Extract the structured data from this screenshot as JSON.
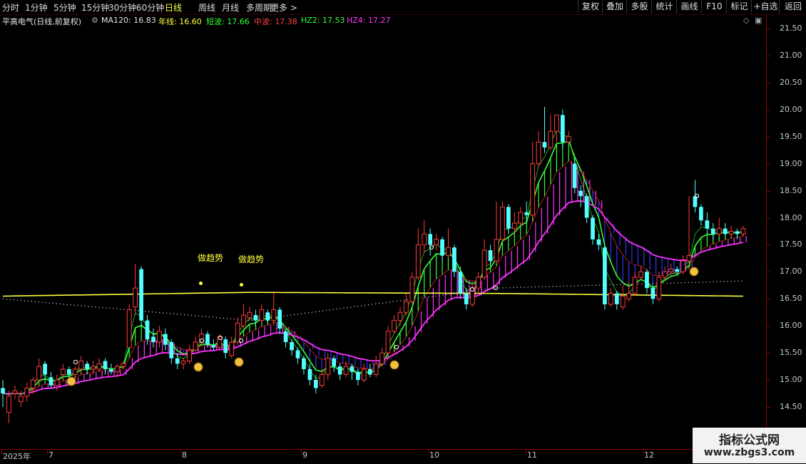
{
  "toolbar": {
    "periods": [
      {
        "label": "分时",
        "active": false
      },
      {
        "label": "1分钟",
        "active": false
      },
      {
        "label": "5分钟",
        "active": false
      },
      {
        "label": "15分钟",
        "active": false
      },
      {
        "label": "30分钟",
        "active": false
      },
      {
        "label": "60分钟",
        "active": false
      },
      {
        "label": "日线",
        "active": true
      },
      {
        "label": "周线",
        "active": false
      },
      {
        "label": "月线",
        "active": false
      },
      {
        "label": "多周期",
        "active": false
      },
      {
        "label": "更多 >",
        "active": false
      }
    ],
    "right_buttons": [
      "复权",
      "叠加",
      "多股",
      "统计",
      "画线",
      "F10",
      "标记",
      "+自选",
      "返回"
    ]
  },
  "info": {
    "stock_title": "平高电气(日线,前复权)",
    "ma_label": "MA120: 16.83",
    "nianxian": "年线: 16.60",
    "duanbo": "短波: 17.66",
    "zhongbo": "中波: 17.38",
    "hz2": "HZ2: 17.53",
    "hz4": "HZ4: 17.27"
  },
  "colors": {
    "up": "#ff3b3b",
    "down": "#54ffff",
    "yellow": "#ffff40",
    "green_band": "#33ff33",
    "magenta_band": "#ff33ff",
    "blue_band": "#3333ff",
    "white_dots": "#e0e0e0"
  },
  "y_axis": [
    "21.50",
    "21.00",
    "20.50",
    "20.00",
    "19.50",
    "19.00",
    "18.50",
    "18.00",
    "17.50",
    "17.00",
    "16.50",
    "16.00",
    "15.50",
    "15.00",
    "14.50"
  ],
  "x_axis": [
    "2025年",
    "7",
    "8",
    "9",
    "10",
    "11",
    "12"
  ],
  "annotations": [
    "做趋势",
    "做趋势"
  ],
  "watermark": {
    "line1": "指标公式网",
    "line2": "www.zbgs3.com"
  },
  "chart_data": {
    "type": "candlestick",
    "title": "平高电气(日线,前复权)",
    "ylim": [
      14.2,
      21.7
    ],
    "candles": [
      [
        14.85,
        14.75,
        15.0,
        14.5
      ],
      [
        14.4,
        14.7,
        14.8,
        14.2
      ],
      [
        14.75,
        14.8,
        14.9,
        14.65
      ],
      [
        14.6,
        14.7,
        14.8,
        14.5
      ],
      [
        14.7,
        14.85,
        14.95,
        14.6
      ],
      [
        14.85,
        15.0,
        15.05,
        14.75
      ],
      [
        15.0,
        15.25,
        15.4,
        14.95
      ],
      [
        15.3,
        15.1,
        15.35,
        15.0
      ],
      [
        15.05,
        14.9,
        15.15,
        14.85
      ],
      [
        14.9,
        15.0,
        15.1,
        14.8
      ],
      [
        15.1,
        15.2,
        15.3,
        15.0
      ],
      [
        15.2,
        15.1,
        15.25,
        15.05
      ],
      [
        15.1,
        15.2,
        15.25,
        15.0
      ],
      [
        15.2,
        15.35,
        15.45,
        15.1
      ],
      [
        15.3,
        15.2,
        15.35,
        15.1
      ],
      [
        15.2,
        15.25,
        15.35,
        15.1
      ],
      [
        15.2,
        15.3,
        15.4,
        15.15
      ],
      [
        15.35,
        15.2,
        15.4,
        15.1
      ],
      [
        15.2,
        15.15,
        15.3,
        15.1
      ],
      [
        15.15,
        15.25,
        15.3,
        15.05
      ],
      [
        15.25,
        15.3,
        15.35,
        15.2
      ],
      [
        15.6,
        16.3,
        16.4,
        15.6
      ],
      [
        16.35,
        16.7,
        17.15,
        16.2
      ],
      [
        17.05,
        16.1,
        17.1,
        16.0
      ],
      [
        16.1,
        15.75,
        16.2,
        15.65
      ],
      [
        15.8,
        15.7,
        15.95,
        15.6
      ],
      [
        15.7,
        15.9,
        16.0,
        15.6
      ],
      [
        15.85,
        15.65,
        15.95,
        15.55
      ],
      [
        15.7,
        15.4,
        15.75,
        15.3
      ],
      [
        15.4,
        15.3,
        15.5,
        15.2
      ],
      [
        15.3,
        15.35,
        15.4,
        15.2
      ],
      [
        15.35,
        15.55,
        15.65,
        15.3
      ],
      [
        15.55,
        15.7,
        15.8,
        15.5
      ],
      [
        15.7,
        15.85,
        15.95,
        15.65
      ],
      [
        15.85,
        15.65,
        15.9,
        15.6
      ],
      [
        15.65,
        15.6,
        15.75,
        15.55
      ],
      [
        15.6,
        15.8,
        15.85,
        15.55
      ],
      [
        15.75,
        15.5,
        15.8,
        15.4
      ],
      [
        15.45,
        15.7,
        15.8,
        15.4
      ],
      [
        15.7,
        16.05,
        16.15,
        15.65
      ],
      [
        16.0,
        16.2,
        16.4,
        15.95
      ],
      [
        16.15,
        16.25,
        16.35,
        16.1
      ],
      [
        16.2,
        16.1,
        16.3,
        16.0
      ],
      [
        16.1,
        16.3,
        16.4,
        16.05
      ],
      [
        16.25,
        16.1,
        16.3,
        16.05
      ],
      [
        16.1,
        16.3,
        16.6,
        16.0
      ],
      [
        16.3,
        15.95,
        16.35,
        15.85
      ],
      [
        15.9,
        15.7,
        15.95,
        15.6
      ],
      [
        15.7,
        15.55,
        15.75,
        15.45
      ],
      [
        15.55,
        15.4,
        15.6,
        15.3
      ],
      [
        15.4,
        15.2,
        15.45,
        15.1
      ],
      [
        15.2,
        15.0,
        15.3,
        14.9
      ],
      [
        15.0,
        14.85,
        15.1,
        14.75
      ],
      [
        14.9,
        15.1,
        15.2,
        14.85
      ],
      [
        15.1,
        15.4,
        15.5,
        15.0
      ],
      [
        15.4,
        15.25,
        15.45,
        15.15
      ],
      [
        15.25,
        15.1,
        15.3,
        15.0
      ],
      [
        15.1,
        15.25,
        15.35,
        15.05
      ],
      [
        15.25,
        15.15,
        15.3,
        15.0
      ],
      [
        15.15,
        15.0,
        15.2,
        14.9
      ],
      [
        15.0,
        15.2,
        15.3,
        14.95
      ],
      [
        15.2,
        15.1,
        15.3,
        15.05
      ],
      [
        15.1,
        15.3,
        15.45,
        15.05
      ],
      [
        15.3,
        15.5,
        15.6,
        15.25
      ],
      [
        15.5,
        15.9,
        16.0,
        15.45
      ],
      [
        15.9,
        16.1,
        16.2,
        15.85
      ],
      [
        16.1,
        16.25,
        16.35,
        16.0
      ],
      [
        16.25,
        16.45,
        16.6,
        16.2
      ],
      [
        16.45,
        16.9,
        17.0,
        16.4
      ],
      [
        16.9,
        17.5,
        17.8,
        16.85
      ],
      [
        17.5,
        17.7,
        17.95,
        17.35
      ],
      [
        17.7,
        17.5,
        17.8,
        17.3
      ],
      [
        17.5,
        17.6,
        17.7,
        17.4
      ],
      [
        17.6,
        17.3,
        17.65,
        17.2
      ],
      [
        17.3,
        17.45,
        17.8,
        17.25
      ],
      [
        17.45,
        17.0,
        17.5,
        16.9
      ],
      [
        17.0,
        16.6,
        17.1,
        16.5
      ],
      [
        16.6,
        16.4,
        16.7,
        16.3
      ],
      [
        16.4,
        16.7,
        16.8,
        16.35
      ],
      [
        16.7,
        16.9,
        17.0,
        16.6
      ],
      [
        16.9,
        17.4,
        17.6,
        16.85
      ],
      [
        17.4,
        17.2,
        17.5,
        17.1
      ],
      [
        17.2,
        17.6,
        18.3,
        17.15
      ],
      [
        17.6,
        18.2,
        18.3,
        17.55
      ],
      [
        18.2,
        17.8,
        18.25,
        17.7
      ],
      [
        17.8,
        17.9,
        18.1,
        17.7
      ],
      [
        17.9,
        18.1,
        18.2,
        17.85
      ],
      [
        18.1,
        18.05,
        18.3,
        17.9
      ],
      [
        18.05,
        19.0,
        19.4,
        18.0
      ],
      [
        19.0,
        19.4,
        19.6,
        18.95
      ],
      [
        19.4,
        19.3,
        20.05,
        19.2
      ],
      [
        19.3,
        19.6,
        19.9,
        19.25
      ],
      [
        19.6,
        19.9,
        19.9,
        19.4
      ],
      [
        19.9,
        19.4,
        20.0,
        19.3
      ],
      [
        19.4,
        19.5,
        19.6,
        19.35
      ],
      [
        19.0,
        18.55,
        19.05,
        18.45
      ],
      [
        18.5,
        18.4,
        18.6,
        18.2
      ],
      [
        18.4,
        18.0,
        18.45,
        17.9
      ],
      [
        18.0,
        17.6,
        18.05,
        17.5
      ],
      [
        17.6,
        17.5,
        17.7,
        17.4
      ],
      [
        17.45,
        16.4,
        17.5,
        16.3
      ],
      [
        16.4,
        16.6,
        16.7,
        16.35
      ],
      [
        16.6,
        16.4,
        16.65,
        16.3
      ],
      [
        16.35,
        16.55,
        16.75,
        16.3
      ],
      [
        16.5,
        16.6,
        16.8,
        16.45
      ],
      [
        16.6,
        16.9,
        17.0,
        16.55
      ],
      [
        16.9,
        17.0,
        17.1,
        16.85
      ],
      [
        17.0,
        16.7,
        17.05,
        16.6
      ],
      [
        16.7,
        16.5,
        16.75,
        16.4
      ],
      [
        16.5,
        16.9,
        17.0,
        16.45
      ],
      [
        16.9,
        17.0,
        17.1,
        16.85
      ],
      [
        17.0,
        17.05,
        17.15,
        16.95
      ],
      [
        17.05,
        17.0,
        17.1,
        16.95
      ],
      [
        17.0,
        17.2,
        17.3,
        16.95
      ],
      [
        17.2,
        17.3,
        18.4,
        17.15
      ],
      [
        18.4,
        18.2,
        18.7,
        18.1
      ],
      [
        18.2,
        17.95,
        18.25,
        17.85
      ],
      [
        17.95,
        17.8,
        18.1,
        17.7
      ],
      [
        17.8,
        17.7,
        17.9,
        17.6
      ],
      [
        17.7,
        17.8,
        18.0,
        17.65
      ],
      [
        17.8,
        17.7,
        17.9,
        17.65
      ],
      [
        17.7,
        17.75,
        17.85,
        17.65
      ],
      [
        17.75,
        17.7,
        17.8,
        17.6
      ],
      [
        17.7,
        17.8,
        17.85,
        17.65
      ]
    ],
    "series": [
      {
        "name": "年线",
        "values": [
          16.55,
          16.62,
          16.6,
          16.55
        ]
      },
      {
        "name": "MA120",
        "values": [
          16.5,
          16.1,
          16.7,
          16.83
        ]
      }
    ]
  }
}
